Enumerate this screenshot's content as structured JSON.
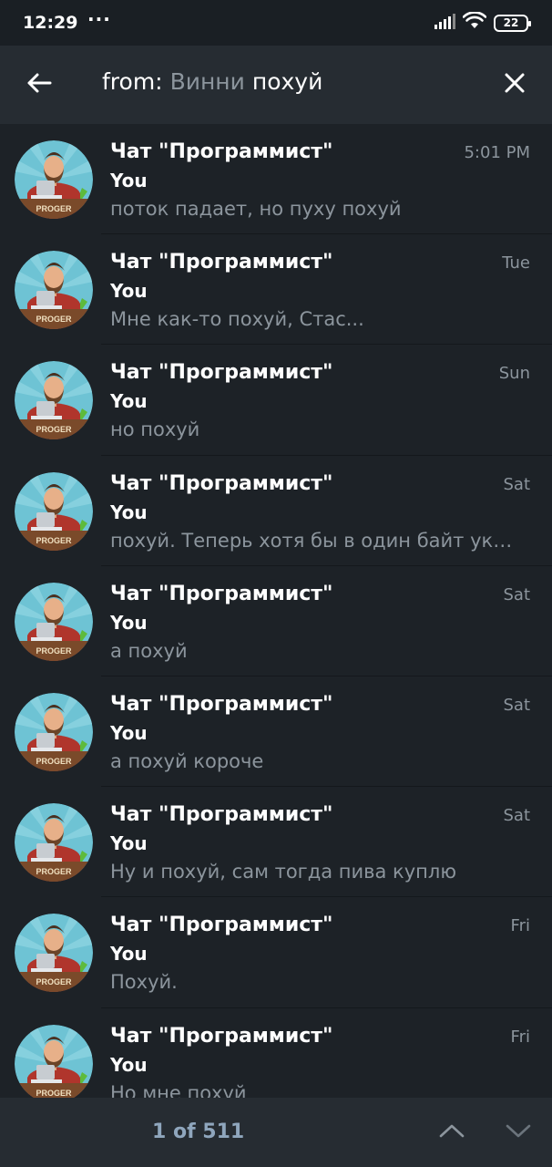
{
  "status_bar": {
    "time": "12:29",
    "dots": "···",
    "battery": "22",
    "icons": [
      "signal-icon",
      "wifi-icon",
      "battery-icon"
    ]
  },
  "search": {
    "prefix": "from: ",
    "chip": "Винни",
    "query": " похуй",
    "back_icon": "arrow-left-icon",
    "clear_icon": "close-icon"
  },
  "results": [
    {
      "chat": "Чат \"Программист\"",
      "date": "5:01 PM",
      "sender": "You",
      "text": "поток падает, но пуху похуй"
    },
    {
      "chat": "Чат \"Программист\"",
      "date": "Tue",
      "sender": "You",
      "text": "Мне как-то похуй, Стас..."
    },
    {
      "chat": "Чат \"Программист\"",
      "date": "Sun",
      "sender": "You",
      "text": "но похуй"
    },
    {
      "chat": "Чат \"Программист\"",
      "date": "Sat",
      "sender": "You",
      "text": "похуй. Теперь хотя бы в один байт укл..."
    },
    {
      "chat": "Чат \"Программист\"",
      "date": "Sat",
      "sender": "You",
      "text": "а похуй"
    },
    {
      "chat": "Чат \"Программист\"",
      "date": "Sat",
      "sender": "You",
      "text": "а похуй короче"
    },
    {
      "chat": "Чат \"Программист\"",
      "date": "Sat",
      "sender": "You",
      "text": "Ну и похуй, сам тогда пива куплю"
    },
    {
      "chat": "Чат \"Программист\"",
      "date": "Fri",
      "sender": "You",
      "text": "Похуй."
    },
    {
      "chat": "Чат \"Программист\"",
      "date": "Fri",
      "sender": "You",
      "text": "Но мне похуй"
    }
  ],
  "avatar_badge": "PROGER",
  "footer": {
    "counter": "1 of 511",
    "up_icon": "chevron-up-icon",
    "down_icon": "chevron-down-icon"
  },
  "colors": {
    "background": "#1d2227",
    "header": "#262c32",
    "muted_text": "#8c959d",
    "accent": "#8fa6bd"
  }
}
